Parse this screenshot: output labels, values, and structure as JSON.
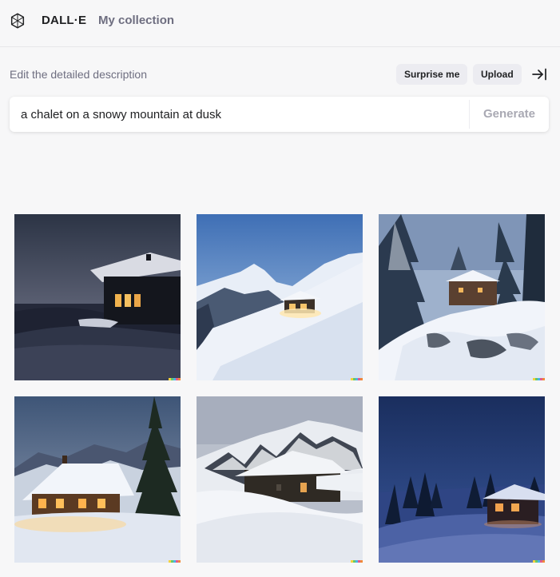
{
  "header": {
    "brand": "DALL·E",
    "nav_link": "My collection",
    "logo_icon": "openai-logo-icon"
  },
  "prompt": {
    "label": "Edit the detailed description",
    "surprise_label": "Surprise me",
    "upload_label": "Upload",
    "collapse_icon": "arrow-to-right-icon",
    "value": "a chalet on a snowy mountain at dusk",
    "generate_label": "Generate"
  },
  "results": {
    "images": [
      {
        "id": "image-1",
        "scene": "dark chalet on snowy ridge at dusk"
      },
      {
        "id": "image-2",
        "scene": "lit chalet on snowy mountain slope"
      },
      {
        "id": "image-3",
        "scene": "chalet among snowy pines on rocks"
      },
      {
        "id": "image-4",
        "scene": "glowing chalet beside tall pine"
      },
      {
        "id": "image-5",
        "scene": "chalet buried in snow under peaks"
      },
      {
        "id": "image-6",
        "scene": "cabin in blue snowy forest at night"
      }
    ],
    "signature_colors": [
      "#f5d33b",
      "#67c967",
      "#4ab3e8",
      "#e25a8c",
      "#f08a3a"
    ]
  },
  "colors": {
    "background": "#f7f7f8",
    "pill": "#ececf1",
    "muted_text": "#6e6e80",
    "generate_disabled": "#a9a9b3"
  }
}
